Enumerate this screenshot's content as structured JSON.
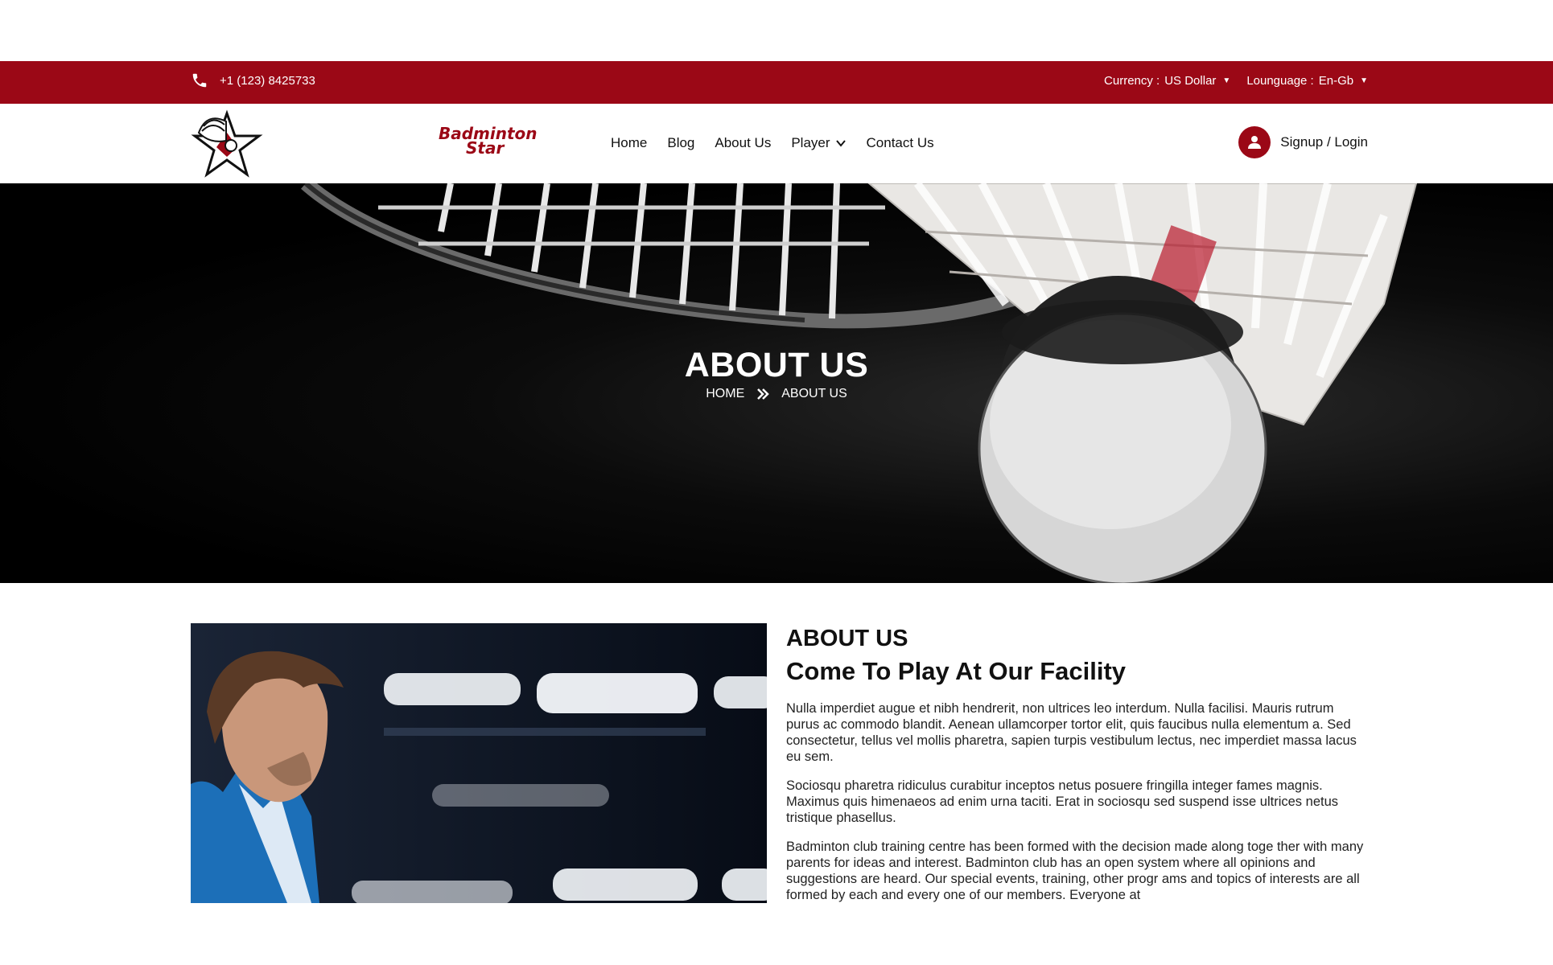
{
  "topbar": {
    "phone": "+1 (123) 8425733",
    "currency_label": "Currency :",
    "currency_value": "US Dollar",
    "language_label": "Lounguage :",
    "language_value": "En-Gb"
  },
  "header": {
    "logo_line1": "Badminton",
    "logo_line2": "Star",
    "nav": [
      "Home",
      "Blog",
      "About Us",
      "Player",
      "Contact Us"
    ],
    "auth": "Signup / Login"
  },
  "hero": {
    "title": "ABOUT US",
    "breadcrumb_home": "HOME",
    "breadcrumb_current": "ABOUT US"
  },
  "about": {
    "kicker": "ABOUT US",
    "heading": "Come To Play At Our Facility",
    "paragraphs": [
      "Nulla imperdiet augue et nibh hendrerit, non ultrices leo interdum. Nulla facilisi. Mauris rutrum purus ac commodo blandit. Aenean ullamcorper tortor elit, quis faucibus nulla elementum a. Sed consectetur, tellus vel mollis pharetra, sapien turpis vestibulum lectus, nec imperdiet massa lacus eu sem.",
      "Sociosqu pharetra ridiculus curabitur inceptos netus posuere fringilla integer fames magnis. Maximus quis himenaeos ad enim urna taciti. Erat in sociosqu sed suspend isse ultrices netus tristique phasellus.",
      "Badminton club training centre has been formed with the decision made along toge ther with many parents for ideas and interest. Badminton club has an open system where all opinions and suggestions are heard. Our special events, training, other progr ams and topics of interests are all formed by each and every one of our members. Everyone at"
    ]
  },
  "colors": {
    "brand": "#9b0816",
    "text": "#111111"
  },
  "icons": [
    "phone-icon",
    "caret-down-icon",
    "chevron-down-icon",
    "user-icon",
    "double-chevron-right-icon"
  ]
}
